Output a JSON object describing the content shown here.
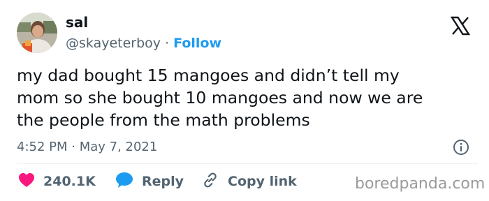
{
  "author": {
    "display_name": "sal",
    "handle": "@skayeterboy",
    "separator": " · ",
    "follow_label": "Follow"
  },
  "icons": {
    "platform": "x-logo-icon",
    "info": "info-icon",
    "like": "heart-icon",
    "reply": "speech-bubble-icon",
    "copy_link": "link-icon"
  },
  "tweet": {
    "text": "my dad bought 15 mangoes and didn’t tell my\nmom so she bought 10 mangoes and now we are\nthe people from the math problems",
    "timestamp": "4:52 PM · May 7, 2021"
  },
  "actions": {
    "like_count": "240.1K",
    "reply_label": "Reply",
    "copy_link_label": "Copy link"
  },
  "watermark": "boredpanda.com",
  "colors": {
    "accent": "#1d9bf0",
    "like": "#f91880",
    "secondary_text": "#536471",
    "primary_text": "#0f1419",
    "watermark": "#9a9a9a"
  }
}
